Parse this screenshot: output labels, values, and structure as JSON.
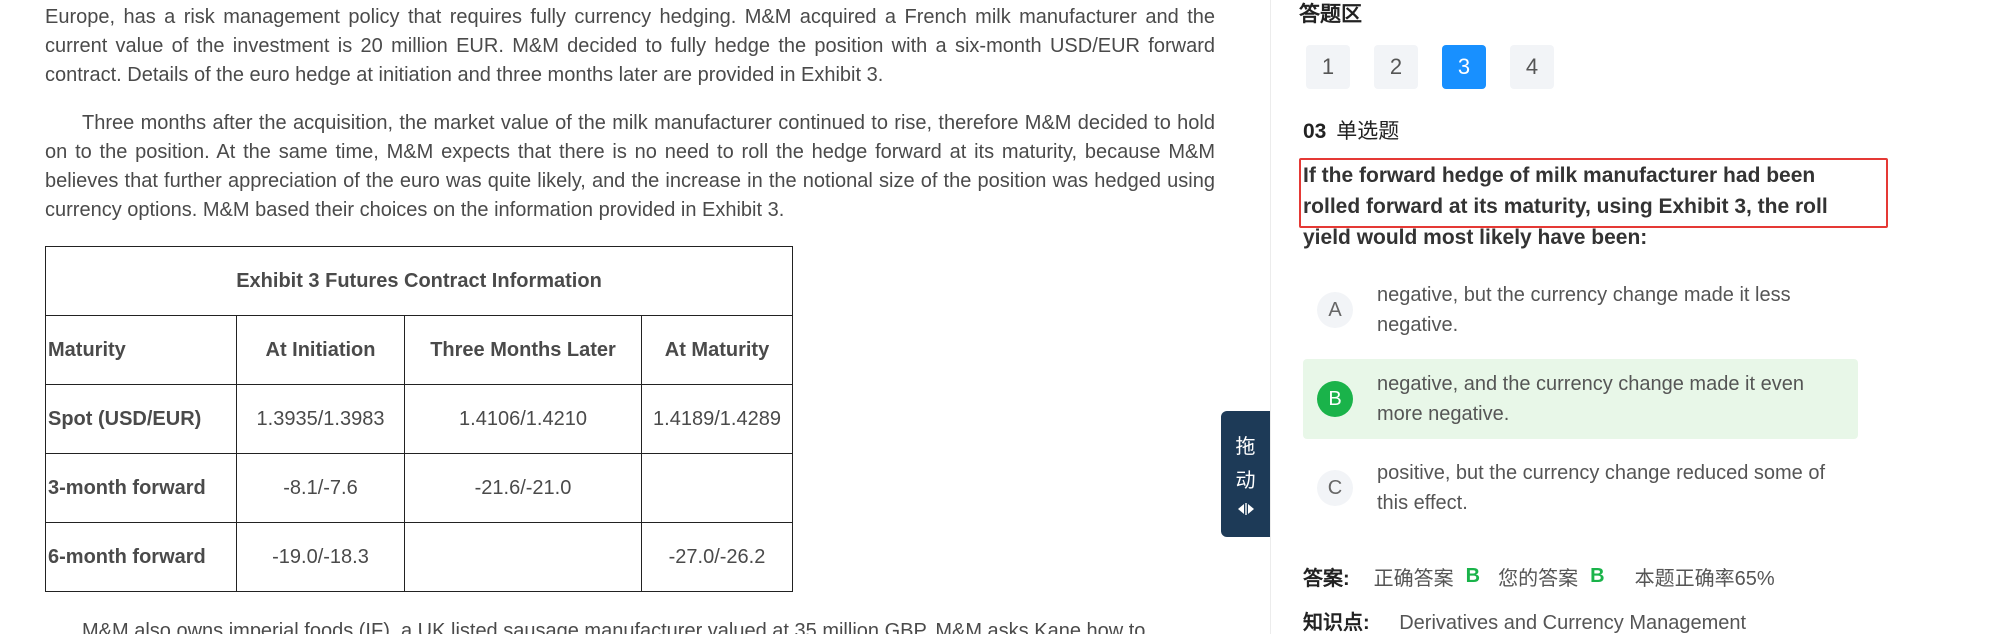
{
  "passage": {
    "p1": "Europe, has a risk management policy that requires fully currency hedging. M&M acquired a French milk manufacturer and the current value of the investment is 20 million EUR. M&M decided to fully hedge the position with a six-month USD/EUR forward contract. Details of the euro hedge at initiation and three months later are provided in Exhibit 3.",
    "p2": "Three months after the acquisition, the market value of the milk manufacturer continued to rise, therefore M&M decided to hold on to the position. At the same time, M&M expects that there is no need to roll the hedge forward at its maturity, because M&M believes that further appreciation of the euro was quite likely, and the increase in the notional size of the position was hedged using currency options. M&M based their choices on the information provided in Exhibit 3.",
    "p3": "M&M also owns imperial foods (IF), a UK listed sausage manufacturer valued at 35 million GBP. M&M asks Kane how to"
  },
  "exhibit": {
    "caption": "Exhibit 3 Futures Contract Information",
    "headers": [
      "Maturity",
      "At Initiation",
      "Three Months Later",
      "At Maturity"
    ],
    "rows": [
      [
        "Spot (USD/EUR)",
        "1.3935/1.3983",
        "1.4106/1.4210",
        "1.4189/1.4289"
      ],
      [
        "3-month forward",
        "-8.1/-7.6",
        "-21.6/-21.0",
        ""
      ],
      [
        "6-month forward",
        "-19.0/-18.3",
        "",
        "-27.0/-26.2"
      ]
    ]
  },
  "drag_handle": {
    "chars": [
      "拖",
      "动"
    ],
    "icon": "resize-horizontal-icon"
  },
  "answer_panel": {
    "title": "答题区",
    "question_numbers": [
      "1",
      "2",
      "3",
      "4"
    ],
    "active_question": "3",
    "question_number_label": "03",
    "question_type": "单选题",
    "question_text": "If the forward hedge of milk manufacturer had been rolled forward at its maturity, using Exhibit 3, the roll yield would most likely have been:",
    "options": [
      {
        "letter": "A",
        "text": "negative, but the currency change made it less negative.",
        "selected": false
      },
      {
        "letter": "B",
        "text": "negative, and the currency change made it even more negative.",
        "selected": true
      },
      {
        "letter": "C",
        "text": "positive, but the currency change reduced some of this effect.",
        "selected": false
      }
    ],
    "answer_label": "答案:",
    "correct_answer_label": "正确答案",
    "correct_answer": "B",
    "your_answer_label": "您的答案",
    "your_answer": "B",
    "accuracy_text": "本题正确率65%",
    "knowledge_label": "知识点:",
    "knowledge_point": "Derivatives and Currency Management"
  },
  "colors": {
    "accent_blue": "#1890ff",
    "correct_green": "#1ab34a",
    "selected_bg": "#e8f7e8",
    "highlight_red": "#e53935",
    "handle_navy": "#1d3a57"
  }
}
